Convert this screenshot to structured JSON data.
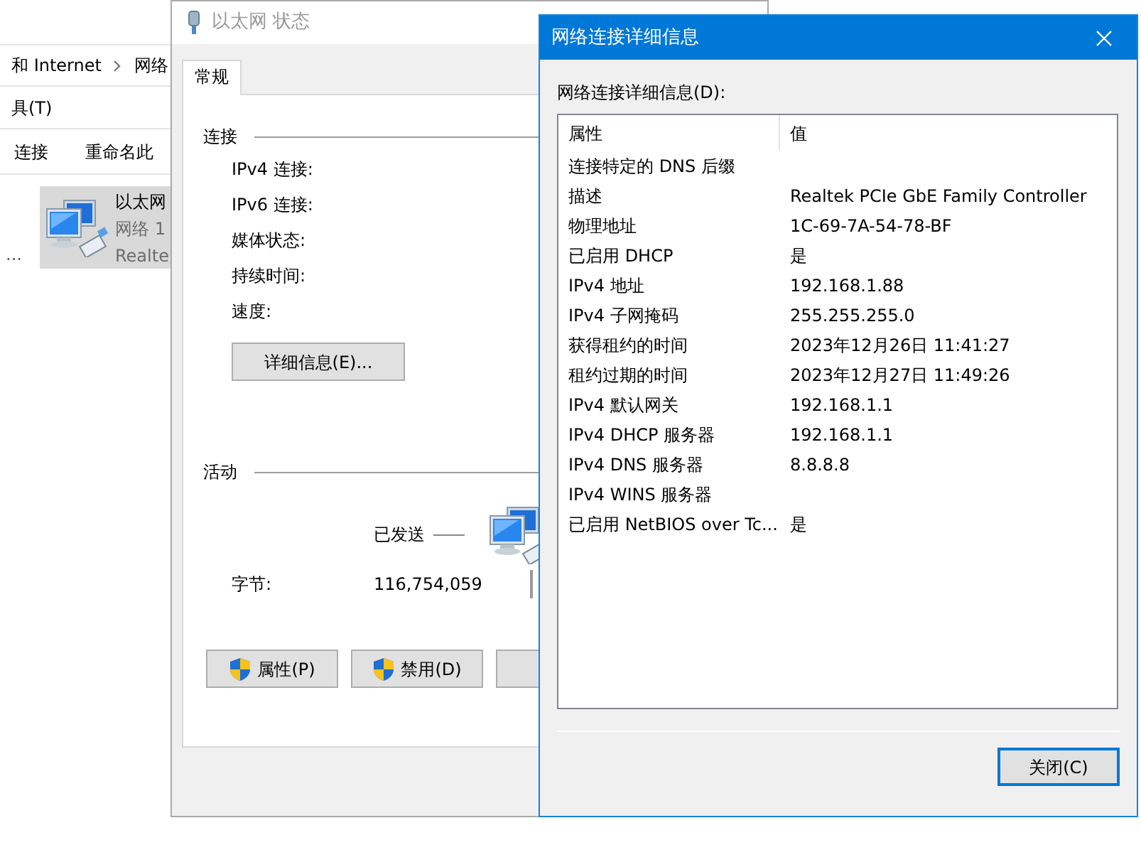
{
  "explorer": {
    "breadcrumb": [
      "和 Internet",
      "网络"
    ],
    "menu": [
      "具(T)"
    ],
    "toolbar": [
      "连接",
      "重命名此"
    ],
    "side_text": "...",
    "adapter": {
      "name": "以太网",
      "network": "网络 1",
      "device": "Realte",
      "selected": true
    }
  },
  "status_window": {
    "title": "以太网 状态",
    "active": false,
    "tabs": [
      {
        "label": "常规",
        "selected": true
      }
    ],
    "connection": {
      "heading": "连接",
      "labels": [
        "IPv4 连接:",
        "IPv6 连接:",
        "媒体状态:",
        "持续时间:",
        "速度:"
      ]
    },
    "details_button": "详细信息(E)...",
    "activity": {
      "heading": "活动",
      "sent_label": "已发送",
      "bytes_label": "字节:",
      "bytes_sent": "116,754,059"
    },
    "buttons": [
      {
        "label": "属性(P)",
        "shield": true
      },
      {
        "label": "禁用(D)",
        "shield": true
      },
      {
        "shield": false
      }
    ]
  },
  "details_dialog": {
    "title": "网络连接详细信息",
    "active": true,
    "label": "网络连接详细信息(D):",
    "columns": [
      "属性",
      "值"
    ],
    "rows": [
      {
        "property": "连接特定的 DNS 后缀"
      },
      {
        "property": "描述",
        "value": "Realtek PCIe GbE Family Controller"
      },
      {
        "property": "物理地址",
        "value": "1C-69-7A-54-78-BF"
      },
      {
        "property": "已启用 DHCP",
        "value": "是"
      },
      {
        "property": "IPv4 地址",
        "value": "192.168.1.88"
      },
      {
        "property": "IPv4 子网掩码",
        "value": "255.255.255.0"
      },
      {
        "property": "获得租约的时间",
        "value": "2023年12月26日 11:41:27"
      },
      {
        "property": "租约过期的时间",
        "value": "2023年12月27日 11:49:26"
      },
      {
        "property": "IPv4 默认网关",
        "value": "192.168.1.1"
      },
      {
        "property": "IPv4 DHCP 服务器",
        "value": "192.168.1.1"
      },
      {
        "property": "IPv4 DNS 服务器",
        "value": "8.8.8.8"
      },
      {
        "property": "IPv4 WINS 服务器"
      },
      {
        "property": "已启用 NetBIOS over Tc...",
        "value": "是"
      }
    ],
    "close_button": "关闭(C)"
  }
}
